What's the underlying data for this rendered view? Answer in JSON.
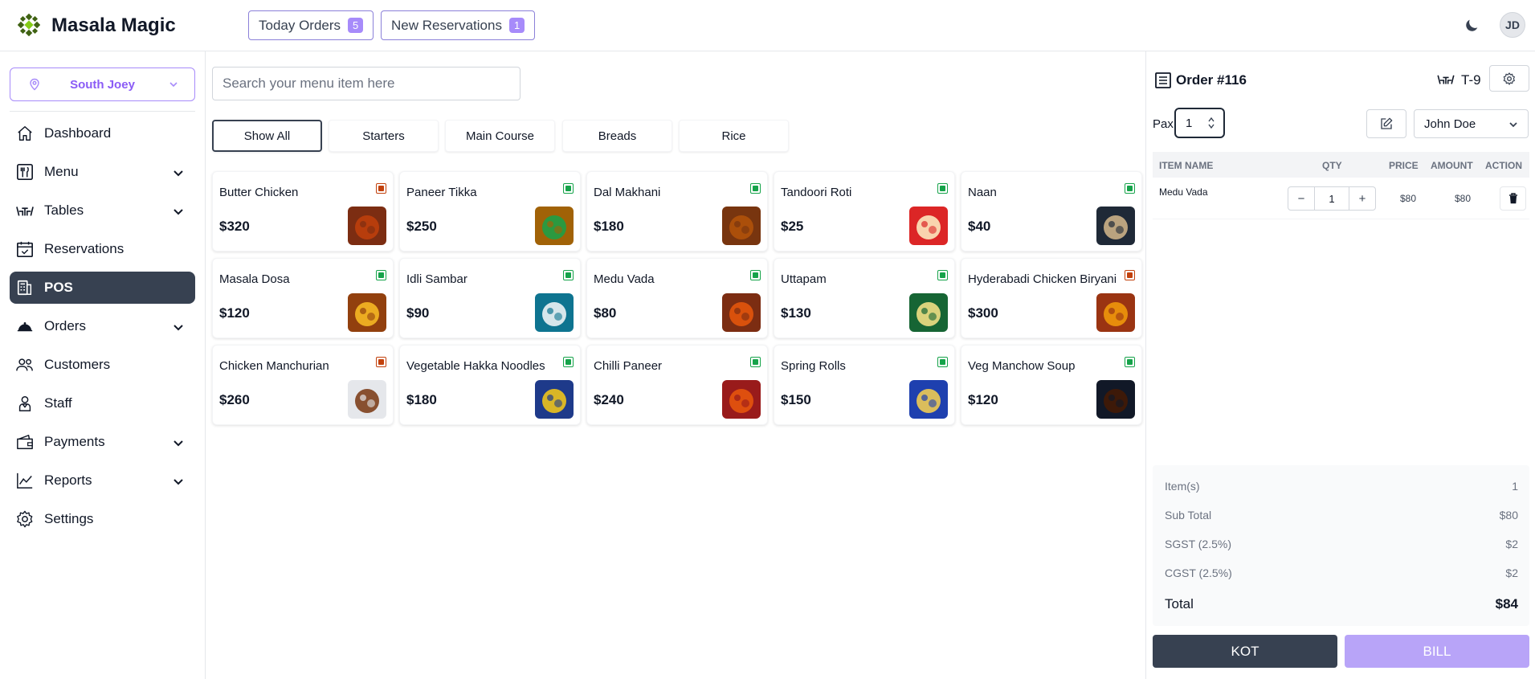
{
  "header": {
    "brand": "Masala Magic",
    "today_orders": {
      "label": "Today Orders",
      "count": "5"
    },
    "new_reservations": {
      "label": "New Reservations",
      "count": "1"
    },
    "avatar_initials": "JD",
    "theme_icon": "moon-icon"
  },
  "sidebar": {
    "location": "South Joey",
    "items": [
      {
        "label": "Dashboard",
        "icon": "home-icon"
      },
      {
        "label": "Menu",
        "icon": "menu-icon",
        "expandable": true
      },
      {
        "label": "Tables",
        "icon": "table-icon",
        "expandable": true
      },
      {
        "label": "Reservations",
        "icon": "calendar-icon"
      },
      {
        "label": "POS",
        "icon": "pos-icon",
        "active": true
      },
      {
        "label": "Orders",
        "icon": "cloche-icon",
        "expandable": true
      },
      {
        "label": "Customers",
        "icon": "users-icon"
      },
      {
        "label": "Staff",
        "icon": "staff-icon"
      },
      {
        "label": "Payments",
        "icon": "wallet-icon",
        "expandable": true
      },
      {
        "label": "Reports",
        "icon": "chart-icon",
        "expandable": true
      },
      {
        "label": "Settings",
        "icon": "gear-icon"
      }
    ]
  },
  "main": {
    "search_placeholder": "Search your menu item here",
    "categories": [
      "Show All",
      "Starters",
      "Main Course",
      "Breads",
      "Rice"
    ],
    "selected_category": "Show All",
    "items": [
      {
        "name": "Butter Chicken",
        "price": "$320",
        "veg": false
      },
      {
        "name": "Paneer Tikka",
        "price": "$250",
        "veg": true
      },
      {
        "name": "Dal Makhani",
        "price": "$180",
        "veg": true
      },
      {
        "name": "Tandoori Roti",
        "price": "$25",
        "veg": true
      },
      {
        "name": "Naan",
        "price": "$40",
        "veg": true
      },
      {
        "name": "Masala Dosa",
        "price": "$120",
        "veg": true
      },
      {
        "name": "Idli Sambar",
        "price": "$90",
        "veg": true
      },
      {
        "name": "Medu Vada",
        "price": "$80",
        "veg": true
      },
      {
        "name": "Uttapam",
        "price": "$130",
        "veg": true
      },
      {
        "name": "Hyderabadi Chicken Biryani",
        "price": "$300",
        "veg": false
      },
      {
        "name": "Chicken Manchurian",
        "price": "$260",
        "veg": false
      },
      {
        "name": "Vegetable Hakka Noodles",
        "price": "$180",
        "veg": true
      },
      {
        "name": "Chilli Paneer",
        "price": "$240",
        "veg": true
      },
      {
        "name": "Spring Rolls",
        "price": "$150",
        "veg": true
      },
      {
        "name": "Veg Manchow Soup",
        "price": "$120",
        "veg": true
      }
    ]
  },
  "order": {
    "title": "Order #116",
    "table": "T-9",
    "pax_label": "Pax",
    "pax_value": "1",
    "customer": "John Doe",
    "columns": {
      "item": "ITEM NAME",
      "qty": "QTY",
      "price": "PRICE",
      "amount": "AMOUNT",
      "action": "ACTION"
    },
    "lines": [
      {
        "name": "Medu Vada",
        "qty": "1",
        "price": "$80",
        "amount": "$80"
      }
    ],
    "summary": [
      {
        "label": "Item(s)",
        "value": "1"
      },
      {
        "label": "Sub Total",
        "value": "$80"
      },
      {
        "label": "SGST (2.5%)",
        "value": "$2"
      },
      {
        "label": "CGST (2.5%)",
        "value": "$2"
      }
    ],
    "total": {
      "label": "Total",
      "value": "$84"
    },
    "kot_label": "KOT",
    "bill_label": "BILL"
  },
  "colors": {
    "accent": "#8b5cf6",
    "dark": "#374151",
    "veg": "#16a34a",
    "nonveg": "#c2410c",
    "bill": "#b8a4f8"
  }
}
